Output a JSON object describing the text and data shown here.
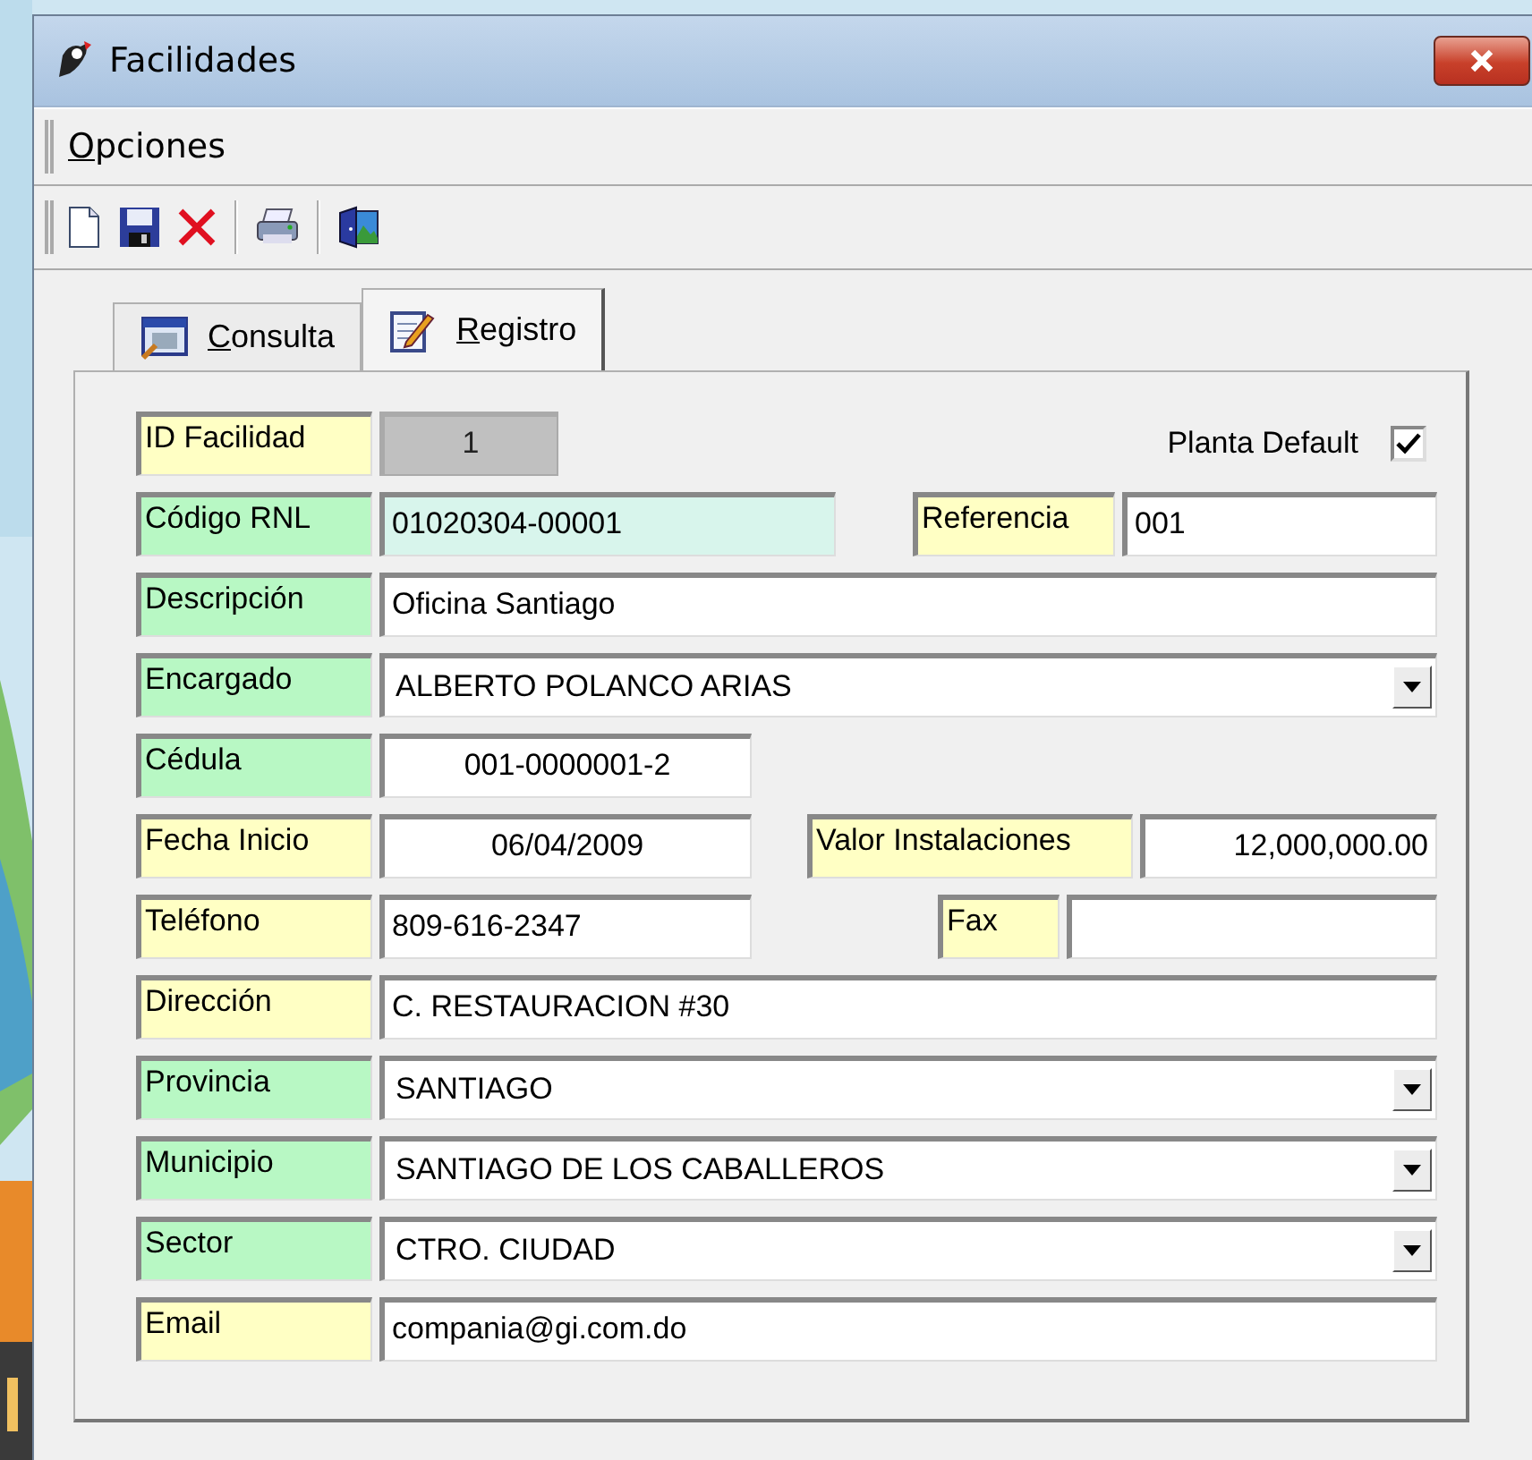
{
  "window": {
    "title": "Facilidades"
  },
  "menu": [
    {
      "label": "Opciones"
    }
  ],
  "tabs": [
    {
      "label": "Consulta",
      "selected": false
    },
    {
      "label": "Registro",
      "selected": true
    }
  ],
  "rows": [
    {
      "items": [
        {
          "kind": "label",
          "text": "ID Facilidad",
          "color": "#ffffc4"
        },
        {
          "kind": "text",
          "value": "1",
          "disabled": true,
          "color": "#c0c0c0"
        },
        {
          "kind": "caption",
          "text": "Planta Default"
        },
        {
          "kind": "checkbox",
          "checked": true
        }
      ]
    },
    {
      "items": [
        {
          "kind": "label",
          "text": "Código RNL",
          "color": "#b8f8c4"
        },
        {
          "kind": "text",
          "value": "01020304-00001",
          "disabled": false,
          "color": "#d8f5ec"
        },
        {
          "kind": "label",
          "text": "Referencia",
          "color": "#ffffc4"
        },
        {
          "kind": "text",
          "value": "001",
          "disabled": false,
          "color": "#ffffff"
        }
      ]
    },
    {
      "items": [
        {
          "kind": "label",
          "text": "Descripción",
          "color": "#b8f8c4"
        },
        {
          "kind": "text",
          "value": "Oficina Santiago",
          "disabled": false,
          "color": "#ffffff"
        }
      ]
    },
    {
      "items": [
        {
          "kind": "label",
          "text": "Encargado",
          "color": "#b8f8c4"
        },
        {
          "kind": "combo",
          "value": "ALBERTO POLANCO ARIAS",
          "disabled": false,
          "color": "#ffffff"
        }
      ]
    },
    {
      "items": [
        {
          "kind": "label",
          "text": "Cédula",
          "color": "#b8f8c4"
        },
        {
          "kind": "text",
          "value": "001-0000001-2",
          "disabled": false,
          "color": "#ffffff"
        }
      ]
    },
    {
      "items": [
        {
          "kind": "label",
          "text": "Fecha Inicio",
          "color": "#ffffc4"
        },
        {
          "kind": "text",
          "value": "06/04/2009",
          "disabled": false,
          "color": "#ffffff"
        },
        {
          "kind": "label",
          "text": "Valor Instalaciones",
          "color": "#ffffc4"
        },
        {
          "kind": "text",
          "value": "12,000,000.00",
          "disabled": false,
          "color": "#ffffff"
        }
      ]
    },
    {
      "items": [
        {
          "kind": "label",
          "text": "Teléfono",
          "color": "#ffffc4"
        },
        {
          "kind": "text",
          "value": "809-616-2347",
          "disabled": false,
          "color": "#ffffff"
        },
        {
          "kind": "label",
          "text": "Fax",
          "color": "#ffffc4"
        },
        {
          "kind": "text",
          "disabled": false,
          "color": "#ffffff"
        }
      ]
    },
    {
      "items": [
        {
          "kind": "label",
          "text": "Dirección",
          "color": "#ffffc4"
        },
        {
          "kind": "text",
          "value": "C. RESTAURACION #30",
          "disabled": false,
          "color": "#ffffff"
        }
      ]
    },
    {
      "items": [
        {
          "kind": "label",
          "text": "Provincia",
          "color": "#b8f8c4"
        },
        {
          "kind": "combo",
          "value": "SANTIAGO",
          "disabled": false,
          "color": "#ffffff"
        }
      ]
    },
    {
      "items": [
        {
          "kind": "label",
          "text": "Municipio",
          "color": "#b8f8c4"
        },
        {
          "kind": "combo",
          "value": "SANTIAGO DE LOS CABALLEROS",
          "disabled": false,
          "color": "#ffffff"
        }
      ]
    },
    {
      "items": [
        {
          "kind": "label",
          "text": "Sector",
          "color": "#b8f8c4"
        },
        {
          "kind": "combo",
          "value": "CTRO. CIUDAD",
          "disabled": false,
          "color": "#ffffff"
        }
      ]
    },
    {
      "items": [
        {
          "kind": "label",
          "text": "Email",
          "color": "#ffffc4"
        },
        {
          "kind": "text",
          "value": "compania@gi.com.do",
          "disabled": false,
          "color": "#ffffff"
        }
      ]
    }
  ]
}
